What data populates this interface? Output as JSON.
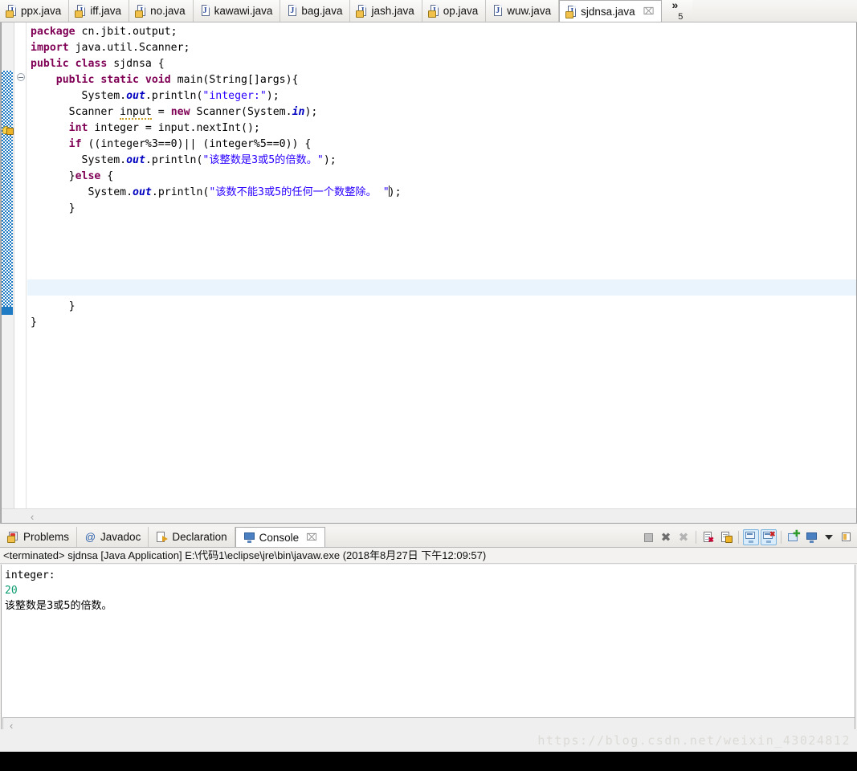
{
  "editor": {
    "tabs": [
      {
        "label": "ppx.java",
        "icon": "java-file-warning-icon",
        "active": false,
        "closable": false
      },
      {
        "label": "iff.java",
        "icon": "java-file-warning-icon",
        "active": false,
        "closable": false
      },
      {
        "label": "no.java",
        "icon": "java-file-warning-icon",
        "active": false,
        "closable": false
      },
      {
        "label": "kawawi.java",
        "icon": "java-file-icon",
        "active": false,
        "closable": false
      },
      {
        "label": "bag.java",
        "icon": "java-file-icon",
        "active": false,
        "closable": false
      },
      {
        "label": "jash.java",
        "icon": "java-file-warning-icon",
        "active": false,
        "closable": false
      },
      {
        "label": "op.java",
        "icon": "java-file-warning-icon",
        "active": false,
        "closable": false
      },
      {
        "label": "wuw.java",
        "icon": "java-file-icon",
        "active": false,
        "closable": false
      },
      {
        "label": "sjdnsa.java",
        "icon": "java-file-warning-icon",
        "active": true,
        "closable": true
      }
    ],
    "close_glyph": "⌧",
    "more_tabs": {
      "chevrons": "»",
      "count": "5"
    },
    "code_lines": [
      "package cn.jbit.output;",
      "import java.util.Scanner;",
      "public class sjdnsa {",
      "    public static void main(String[]args){",
      "        System.out.println(\"integer:\");",
      "      Scanner input = new Scanner(System.in);",
      "      int integer = input.nextInt();",
      "      if ((integer%3==0)|| (integer%5==0)) {",
      "        System.out.println(\"该整数是3或5的倍数。\");",
      "      }else {",
      "         System.out.println(\"该数不能3或5的任何一个数整除。\");",
      "      }",
      "      }",
      "}"
    ],
    "strings": {
      "s1": "\"integer:\"",
      "s2": "\"该整数是3或5的倍数。\"",
      "s3": "\"该数不能3或5的任何一个数整除。 \""
    },
    "scroll_left_glyph": "‹"
  },
  "console_panel": {
    "tabs": [
      {
        "label": "Problems",
        "icon": "problems-icon",
        "active": false
      },
      {
        "label": "Javadoc",
        "icon": "at-sign-icon",
        "active": false
      },
      {
        "label": "Declaration",
        "icon": "declaration-icon",
        "active": false
      },
      {
        "label": "Console",
        "icon": "console-monitor-icon",
        "active": true
      }
    ],
    "close_glyph": "⌧",
    "toolbar": [
      {
        "name": "terminate-button",
        "tooltip": "Terminate",
        "enabled": false
      },
      {
        "name": "remove-launch-button",
        "tooltip": "Remove Launch",
        "enabled": true
      },
      {
        "name": "remove-all-terminated-button",
        "tooltip": "Remove All Terminated Launches",
        "enabled": false
      },
      {
        "name": "clear-console-button",
        "tooltip": "Clear Console",
        "enabled": true
      },
      {
        "name": "scroll-lock-button",
        "tooltip": "Scroll Lock",
        "enabled": true
      },
      {
        "name": "show-console-on-output-button",
        "tooltip": "Show Console When Standard Out Changes",
        "toggled": true
      },
      {
        "name": "show-console-on-error-button",
        "tooltip": "Show Console When Standard Error Changes",
        "toggled": true
      },
      {
        "name": "open-console-button",
        "tooltip": "Open Console",
        "enabled": true
      },
      {
        "name": "display-selected-console-button",
        "tooltip": "Display Selected Console",
        "enabled": true
      },
      {
        "name": "console-dropdown-button",
        "tooltip": "Console Menu",
        "enabled": true
      },
      {
        "name": "pin-console-button",
        "tooltip": "Pin Console",
        "enabled": true
      }
    ],
    "status_line": "<terminated> sjdnsa [Java Application] E:\\代码1\\eclipse\\jre\\bin\\javaw.exe (2018年8月27日 下午12:09:57)",
    "output": {
      "line1": "integer:",
      "line2": "20",
      "line3": "该整数是3或5的倍数。"
    },
    "scroll_left_glyph": "‹"
  },
  "watermark": {
    "text": "https://blog.csdn.net/weixin_43024812"
  },
  "colors": {
    "keyword": "#7f0055",
    "string": "#2a00ff",
    "field": "#0000c0",
    "console_input": "#0a9b6e",
    "changed_marker": "#1f7bc4",
    "current_line": "#eaf4fd",
    "toolbar_toggle": "#d8ecfb"
  }
}
